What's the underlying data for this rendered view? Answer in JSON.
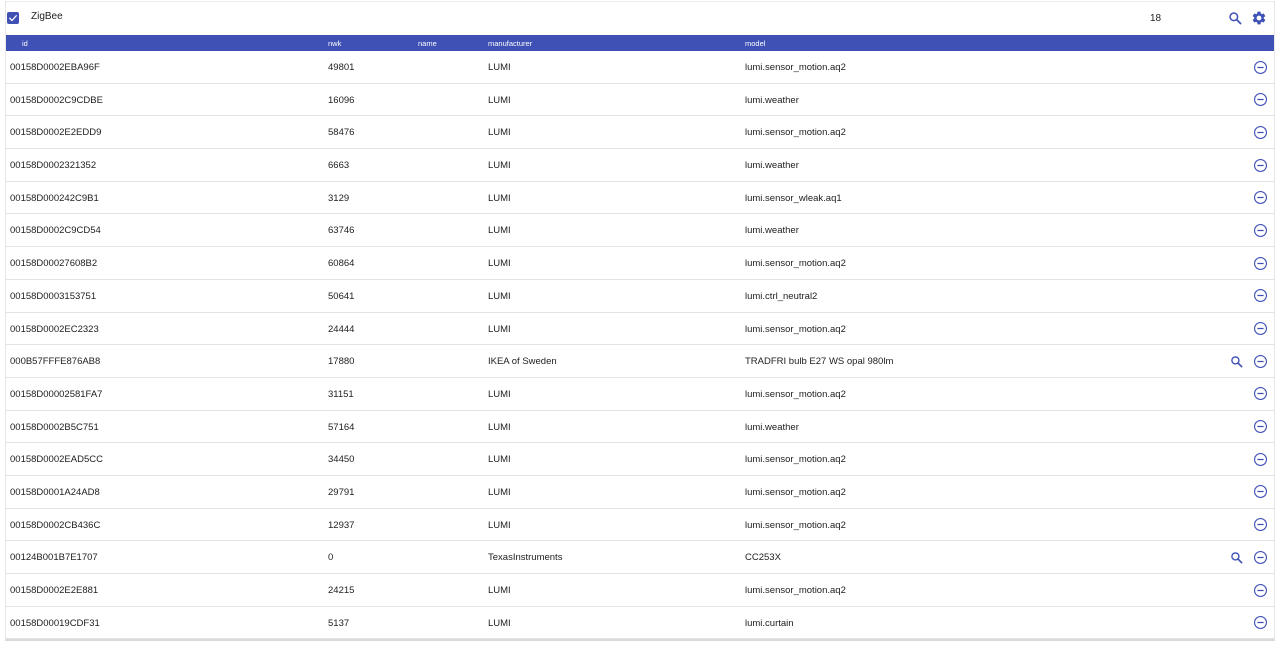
{
  "app": {
    "title": "ZigBee",
    "device_count": "18",
    "checkbox_checked": true,
    "accent_color": "#3f51b5",
    "toolbar_icons": [
      "search-icon",
      "settings-icon"
    ]
  },
  "table": {
    "columns": {
      "id": "id",
      "nwk": "nwk",
      "name": "name",
      "manufacturer": "manufacturer",
      "model": "model"
    },
    "rows": [
      {
        "id": "00158D0002EBA96F",
        "nwk": "49801",
        "name": "",
        "manufacturer": "LUMI",
        "model": "lumi.sensor_motion.aq2",
        "has_search": false
      },
      {
        "id": "00158D0002C9CDBE",
        "nwk": "16096",
        "name": "",
        "manufacturer": "LUMI",
        "model": "lumi.weather",
        "has_search": false
      },
      {
        "id": "00158D0002E2EDD9",
        "nwk": "58476",
        "name": "",
        "manufacturer": "LUMI",
        "model": "lumi.sensor_motion.aq2",
        "has_search": false
      },
      {
        "id": "00158D0002321352",
        "nwk": "6663",
        "name": "",
        "manufacturer": "LUMI",
        "model": "lumi.weather",
        "has_search": false
      },
      {
        "id": "00158D000242C9B1",
        "nwk": "3129",
        "name": "",
        "manufacturer": "LUMI",
        "model": "lumi.sensor_wleak.aq1",
        "has_search": false
      },
      {
        "id": "00158D0002C9CD54",
        "nwk": "63746",
        "name": "",
        "manufacturer": "LUMI",
        "model": "lumi.weather",
        "has_search": false
      },
      {
        "id": "00158D00027608B2",
        "nwk": "60864",
        "name": "",
        "manufacturer": "LUMI",
        "model": "lumi.sensor_motion.aq2",
        "has_search": false
      },
      {
        "id": "00158D0003153751",
        "nwk": "50641",
        "name": "",
        "manufacturer": "LUMI",
        "model": "lumi.ctrl_neutral2",
        "has_search": false
      },
      {
        "id": "00158D0002EC2323",
        "nwk": "24444",
        "name": "",
        "manufacturer": "LUMI",
        "model": "lumi.sensor_motion.aq2",
        "has_search": false
      },
      {
        "id": "000B57FFFE876AB8",
        "nwk": "17880",
        "name": "",
        "manufacturer": "IKEA of Sweden",
        "model": "TRADFRI bulb E27 WS opal 980lm",
        "has_search": true
      },
      {
        "id": "00158D00002581FA7",
        "nwk": "31151",
        "name": "",
        "manufacturer": "LUMI",
        "model": "lumi.sensor_motion.aq2",
        "has_search": false
      },
      {
        "id": "00158D0002B5C751",
        "nwk": "57164",
        "name": "",
        "manufacturer": "LUMI",
        "model": "lumi.weather",
        "has_search": false
      },
      {
        "id": "00158D0002EAD5CC",
        "nwk": "34450",
        "name": "",
        "manufacturer": "LUMI",
        "model": "lumi.sensor_motion.aq2",
        "has_search": false
      },
      {
        "id": "00158D0001A24AD8",
        "nwk": "29791",
        "name": "",
        "manufacturer": "LUMI",
        "model": "lumi.sensor_motion.aq2",
        "has_search": false
      },
      {
        "id": "00158D0002CB436C",
        "nwk": "12937",
        "name": "",
        "manufacturer": "LUMI",
        "model": "lumi.sensor_motion.aq2",
        "has_search": false
      },
      {
        "id": "00124B001B7E1707",
        "nwk": "0",
        "name": "",
        "manufacturer": "TexasInstruments",
        "model": "CC253X",
        "has_search": true
      },
      {
        "id": "00158D0002E2E881",
        "nwk": "24215",
        "name": "",
        "manufacturer": "LUMI",
        "model": "lumi.sensor_motion.aq2",
        "has_search": false
      },
      {
        "id": "00158D00019CDF31",
        "nwk": "5137",
        "name": "",
        "manufacturer": "LUMI",
        "model": "lumi.curtain",
        "has_search": false
      }
    ],
    "row_icons": [
      "search-icon",
      "remove-circle-icon"
    ]
  }
}
